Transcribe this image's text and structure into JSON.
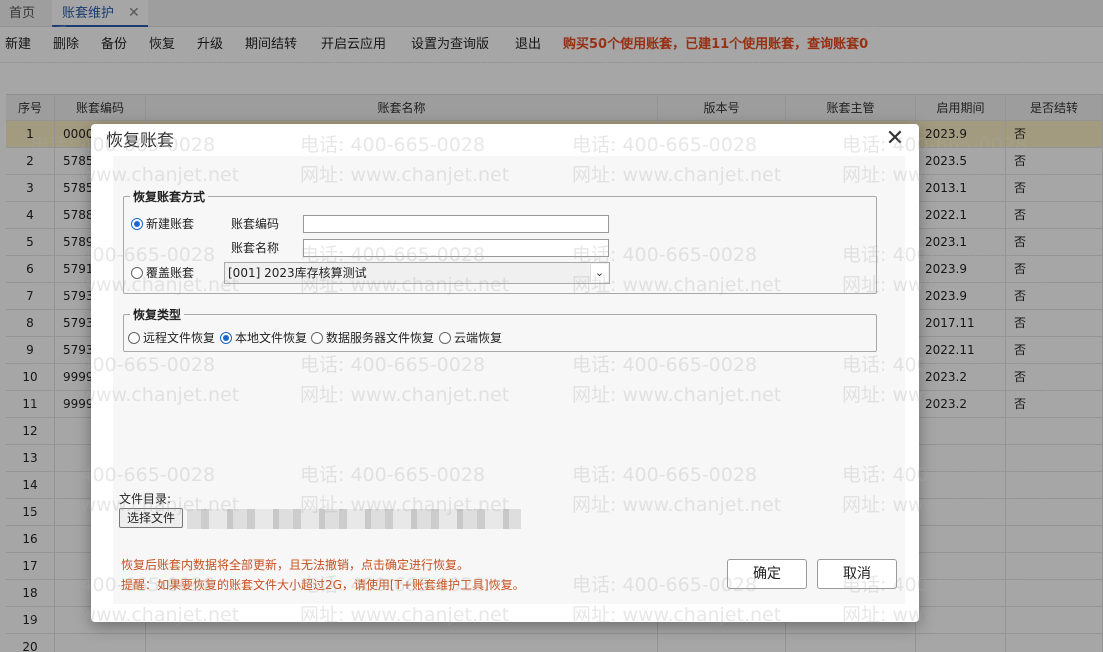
{
  "tabs": {
    "home": "首页",
    "active": "账套维护",
    "close_glyph": "✕"
  },
  "toolbar": {
    "items": [
      "新建",
      "删除",
      "备份",
      "恢复",
      "升级",
      "期间结转",
      "开启云应用",
      "设置为查询版",
      "退出"
    ],
    "notice": "购买50个使用账套，已建11个使用账套，查询账套0"
  },
  "table": {
    "headers": [
      "序号",
      "账套编码",
      "账套名称",
      "版本号",
      "账套主管",
      "启用期间",
      "是否结转"
    ],
    "rows": [
      {
        "seq": "1",
        "code": "0000",
        "period": "2023.9",
        "closed": "否"
      },
      {
        "seq": "2",
        "code": "5785",
        "period": "2023.5",
        "closed": "否"
      },
      {
        "seq": "3",
        "code": "5785",
        "period": "2013.1",
        "closed": "否"
      },
      {
        "seq": "4",
        "code": "5788",
        "period": "2022.1",
        "closed": "否"
      },
      {
        "seq": "5",
        "code": "5789",
        "period": "2023.1",
        "closed": "否"
      },
      {
        "seq": "6",
        "code": "5791",
        "period": "2023.9",
        "closed": "否"
      },
      {
        "seq": "7",
        "code": "5793",
        "period": "2023.9",
        "closed": "否"
      },
      {
        "seq": "8",
        "code": "5793",
        "period": "2017.11",
        "closed": "否"
      },
      {
        "seq": "9",
        "code": "5793",
        "period": "2022.11",
        "closed": "否"
      },
      {
        "seq": "10",
        "code": "9999",
        "period": "2023.2",
        "closed": "否"
      },
      {
        "seq": "11",
        "code": "9999",
        "period": "2023.2",
        "closed": "否"
      },
      {
        "seq": "12",
        "code": "",
        "period": "",
        "closed": ""
      },
      {
        "seq": "13",
        "code": "",
        "period": "",
        "closed": ""
      },
      {
        "seq": "14",
        "code": "",
        "period": "",
        "closed": ""
      },
      {
        "seq": "15",
        "code": "",
        "period": "",
        "closed": ""
      },
      {
        "seq": "16",
        "code": "",
        "period": "",
        "closed": ""
      },
      {
        "seq": "17",
        "code": "",
        "period": "",
        "closed": ""
      },
      {
        "seq": "18",
        "code": "",
        "period": "",
        "closed": ""
      },
      {
        "seq": "19",
        "code": "",
        "period": "",
        "closed": ""
      },
      {
        "seq": "20",
        "code": "",
        "period": "",
        "closed": ""
      }
    ]
  },
  "dialog": {
    "title": "恢复账套",
    "close_glyph": "✕",
    "method": {
      "legend": "恢复账套方式",
      "new_option": "新建账套",
      "code_label": "账套编码",
      "code_value": "",
      "name_label": "账套名称",
      "name_value": "",
      "overwrite_option": "覆盖账套",
      "overwrite_select": "[001] 2023库存核算测试",
      "selected": "新建账套"
    },
    "type": {
      "legend": "恢复类型",
      "options": [
        "远程文件恢复",
        "本地文件恢复",
        "数据服务器文件恢复",
        "云端恢复"
      ],
      "selected": "本地文件恢复"
    },
    "file": {
      "label": "文件目录:",
      "button": "选择文件"
    },
    "warning1": "恢复后账套内数据将全部更新，且无法撤销，点击确定进行恢复。",
    "warning2": "提醒：如果要恢复的账套文件大小超过2G，请使用[T+账套维护工具]恢复。",
    "ok": "确定",
    "cancel": "取消"
  },
  "watermark": {
    "phone": "电话: 400-665-0028",
    "site": "网址: www.chanjet.net"
  }
}
